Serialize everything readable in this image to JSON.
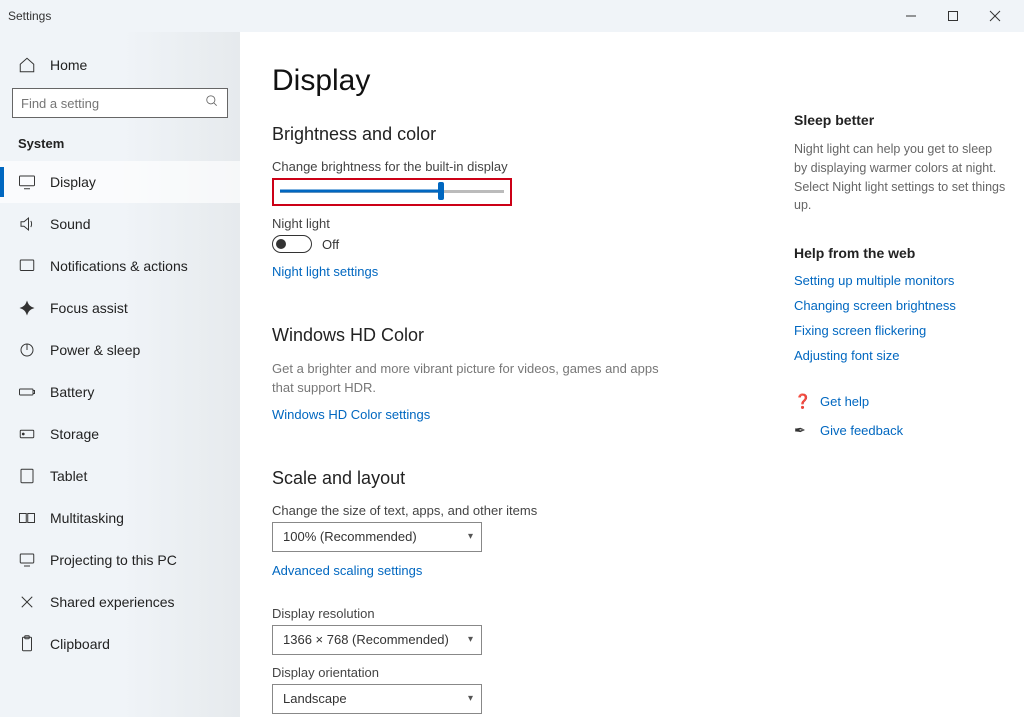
{
  "window": {
    "title": "Settings"
  },
  "sidebar": {
    "home": "Home",
    "search_placeholder": "Find a setting",
    "section": "System",
    "items": [
      {
        "label": "Display"
      },
      {
        "label": "Sound"
      },
      {
        "label": "Notifications & actions"
      },
      {
        "label": "Focus assist"
      },
      {
        "label": "Power & sleep"
      },
      {
        "label": "Battery"
      },
      {
        "label": "Storage"
      },
      {
        "label": "Tablet"
      },
      {
        "label": "Multitasking"
      },
      {
        "label": "Projecting to this PC"
      },
      {
        "label": "Shared experiences"
      },
      {
        "label": "Clipboard"
      }
    ]
  },
  "page": {
    "title": "Display",
    "brightness": {
      "heading": "Brightness and color",
      "slider_label": "Change brightness for the built-in display",
      "slider_percent": 72,
      "night_light_label": "Night light",
      "night_light_state": "Off",
      "night_light_link": "Night light settings"
    },
    "hd": {
      "heading": "Windows HD Color",
      "desc": "Get a brighter and more vibrant picture for videos, games and apps that support HDR.",
      "link": "Windows HD Color settings"
    },
    "scale": {
      "heading": "Scale and layout",
      "size_label": "Change the size of text, apps, and other items",
      "size_value": "100% (Recommended)",
      "advanced_link": "Advanced scaling settings",
      "resolution_label": "Display resolution",
      "resolution_value": "1366 × 768 (Recommended)",
      "orientation_label": "Display orientation",
      "orientation_value": "Landscape"
    }
  },
  "aside": {
    "sleep_heading": "Sleep better",
    "sleep_text": "Night light can help you get to sleep by displaying warmer colors at night. Select Night light settings to set things up.",
    "web_heading": "Help from the web",
    "web_links": [
      "Setting up multiple monitors",
      "Changing screen brightness",
      "Fixing screen flickering",
      "Adjusting font size"
    ],
    "get_help": "Get help",
    "feedback": "Give feedback"
  }
}
